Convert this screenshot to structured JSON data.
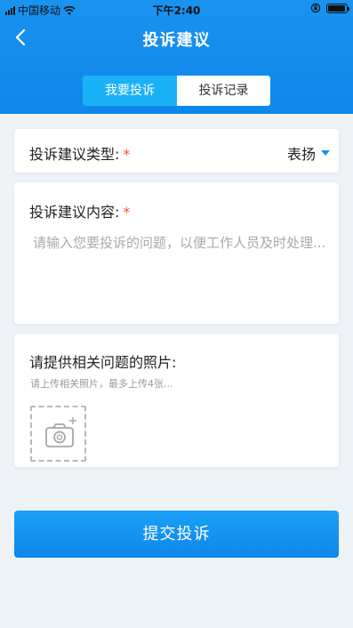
{
  "status_bar": {
    "carrier": "中国移动",
    "time": "下午2:40"
  },
  "nav": {
    "title": "投诉建议",
    "back_icon": "chevron-left-icon"
  },
  "tabs": [
    {
      "label": "我要投诉",
      "active": true
    },
    {
      "label": "投诉记录",
      "active": false
    }
  ],
  "form": {
    "type": {
      "label": "投诉建议类型:",
      "required_mark": "*",
      "value": "表扬"
    },
    "content": {
      "label": "投诉建议内容:",
      "required_mark": "*",
      "placeholder": "请输入您要投诉的问题，以便工作人员及时处理..."
    },
    "photos": {
      "label": "请提供相关问题的照片:",
      "hint": "请上传相关照片，最多上传4张...",
      "upload_icon": "camera-add-icon"
    }
  },
  "submit_label": "提交投诉",
  "colors": {
    "primary": "#0f86ea",
    "tab_active": "#1ab2f7",
    "required": "#f0503c",
    "background": "#eef3f8"
  }
}
